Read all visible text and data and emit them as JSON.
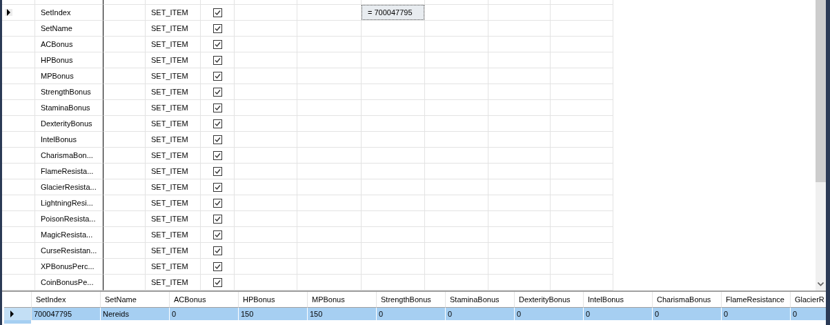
{
  "top_grid": {
    "rows": [
      {
        "name": "SetIndex",
        "type": "SET_ITEM",
        "checked": true,
        "current": true,
        "value": "= 700047795"
      },
      {
        "name": "SetName",
        "type": "SET_ITEM",
        "checked": true,
        "current": false
      },
      {
        "name": "ACBonus",
        "type": "SET_ITEM",
        "checked": true,
        "current": false
      },
      {
        "name": "HPBonus",
        "type": "SET_ITEM",
        "checked": true,
        "current": false
      },
      {
        "name": "MPBonus",
        "type": "SET_ITEM",
        "checked": true,
        "current": false
      },
      {
        "name": "StrengthBonus",
        "type": "SET_ITEM",
        "checked": true,
        "current": false
      },
      {
        "name": "StaminaBonus",
        "type": "SET_ITEM",
        "checked": true,
        "current": false
      },
      {
        "name": "DexterityBonus",
        "type": "SET_ITEM",
        "checked": true,
        "current": false
      },
      {
        "name": "IntelBonus",
        "type": "SET_ITEM",
        "checked": true,
        "current": false
      },
      {
        "name": "CharismaBon...",
        "type": "SET_ITEM",
        "checked": true,
        "current": false
      },
      {
        "name": "FlameResista...",
        "type": "SET_ITEM",
        "checked": true,
        "current": false
      },
      {
        "name": "GlacierResista...",
        "type": "SET_ITEM",
        "checked": true,
        "current": false
      },
      {
        "name": "LightningResi...",
        "type": "SET_ITEM",
        "checked": true,
        "current": false
      },
      {
        "name": "PoisonResista...",
        "type": "SET_ITEM",
        "checked": true,
        "current": false
      },
      {
        "name": "MagicResista...",
        "type": "SET_ITEM",
        "checked": true,
        "current": false
      },
      {
        "name": "CurseResistan...",
        "type": "SET_ITEM",
        "checked": true,
        "current": false
      },
      {
        "name": "XPBonusPerc...",
        "type": "SET_ITEM",
        "checked": true,
        "current": false
      },
      {
        "name": "CoinBonusPe...",
        "type": "SET_ITEM",
        "checked": true,
        "current": false
      }
    ]
  },
  "result_grid": {
    "columns": [
      "SetIndex",
      "SetName",
      "ACBonus",
      "HPBonus",
      "MPBonus",
      "StrengthBonus",
      "StaminaBonus",
      "DexterityBonus",
      "IntelBonus",
      "CharismaBonus",
      "FlameResistance",
      "GlacierR"
    ],
    "rows": [
      {
        "selected": true,
        "current": true,
        "cells": [
          "700047795",
          "Nereids",
          "0",
          "150",
          "150",
          "0",
          "0",
          "0",
          "0",
          "0",
          "0",
          "0"
        ]
      }
    ]
  }
}
